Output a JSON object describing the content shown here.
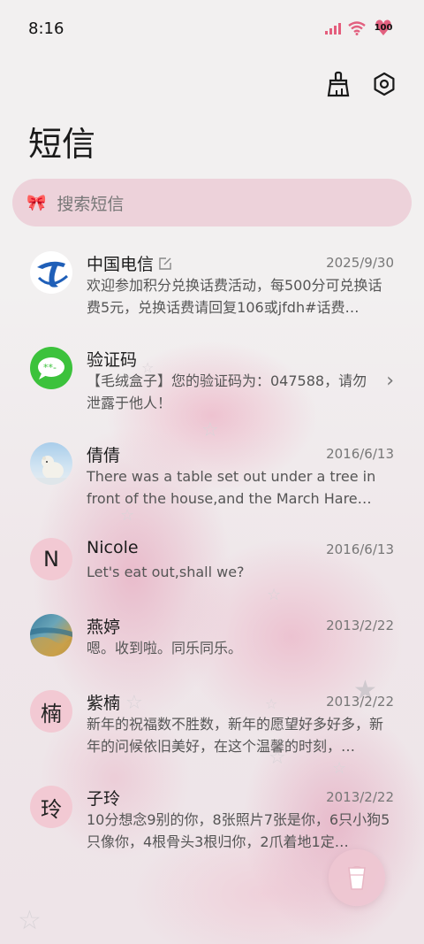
{
  "status": {
    "time": "8:16",
    "battery": "100"
  },
  "header": {
    "title": "短信"
  },
  "search": {
    "placeholder": "搜索短信"
  },
  "threads": [
    {
      "name": "中国电信",
      "date": "2025/9/30",
      "preview": "欢迎参加积分兑换话费活动，每500分可兑换话费5元，兑换话费请回复106或jfdh#话费…",
      "avatar": "telecom-logo"
    },
    {
      "name": "验证码",
      "date": "",
      "preview": "【毛绒盒子】您的验证码为：047588，请勿泄露于他人！",
      "avatar": "message-bubble-icon"
    },
    {
      "name": "倩倩",
      "date": "2016/6/13",
      "preview": "There was a table set out under a tree in front of the house,and the March Hare an…",
      "avatar": "polar-bear-photo"
    },
    {
      "name": "Nicole",
      "date": "2016/6/13",
      "preview": "Let's eat out,shall we?",
      "avatar_letter": "N"
    },
    {
      "name": "燕婷",
      "date": "2013/2/22",
      "preview": "嗯。收到啦。同乐同乐。",
      "avatar": "landscape-photo"
    },
    {
      "name": "紫楠",
      "date": "2013/2/22",
      "preview": "新年的祝福数不胜数，新年的愿望好多好多，新年的问候依旧美好，在这个温馨的时刻，…",
      "avatar_letter": "楠"
    },
    {
      "name": "子玲",
      "date": "2013/2/22",
      "preview": "10分想念9别的你，8张照片7张是你，6只小狗5只像你，4根骨头3根归你，2爪着地1定…",
      "avatar_letter": "玲"
    }
  ],
  "colors": {
    "accent": "#e2607f",
    "search_bg": "#ecd0d8",
    "letter_avatar_bg": "#f2c9d3"
  }
}
